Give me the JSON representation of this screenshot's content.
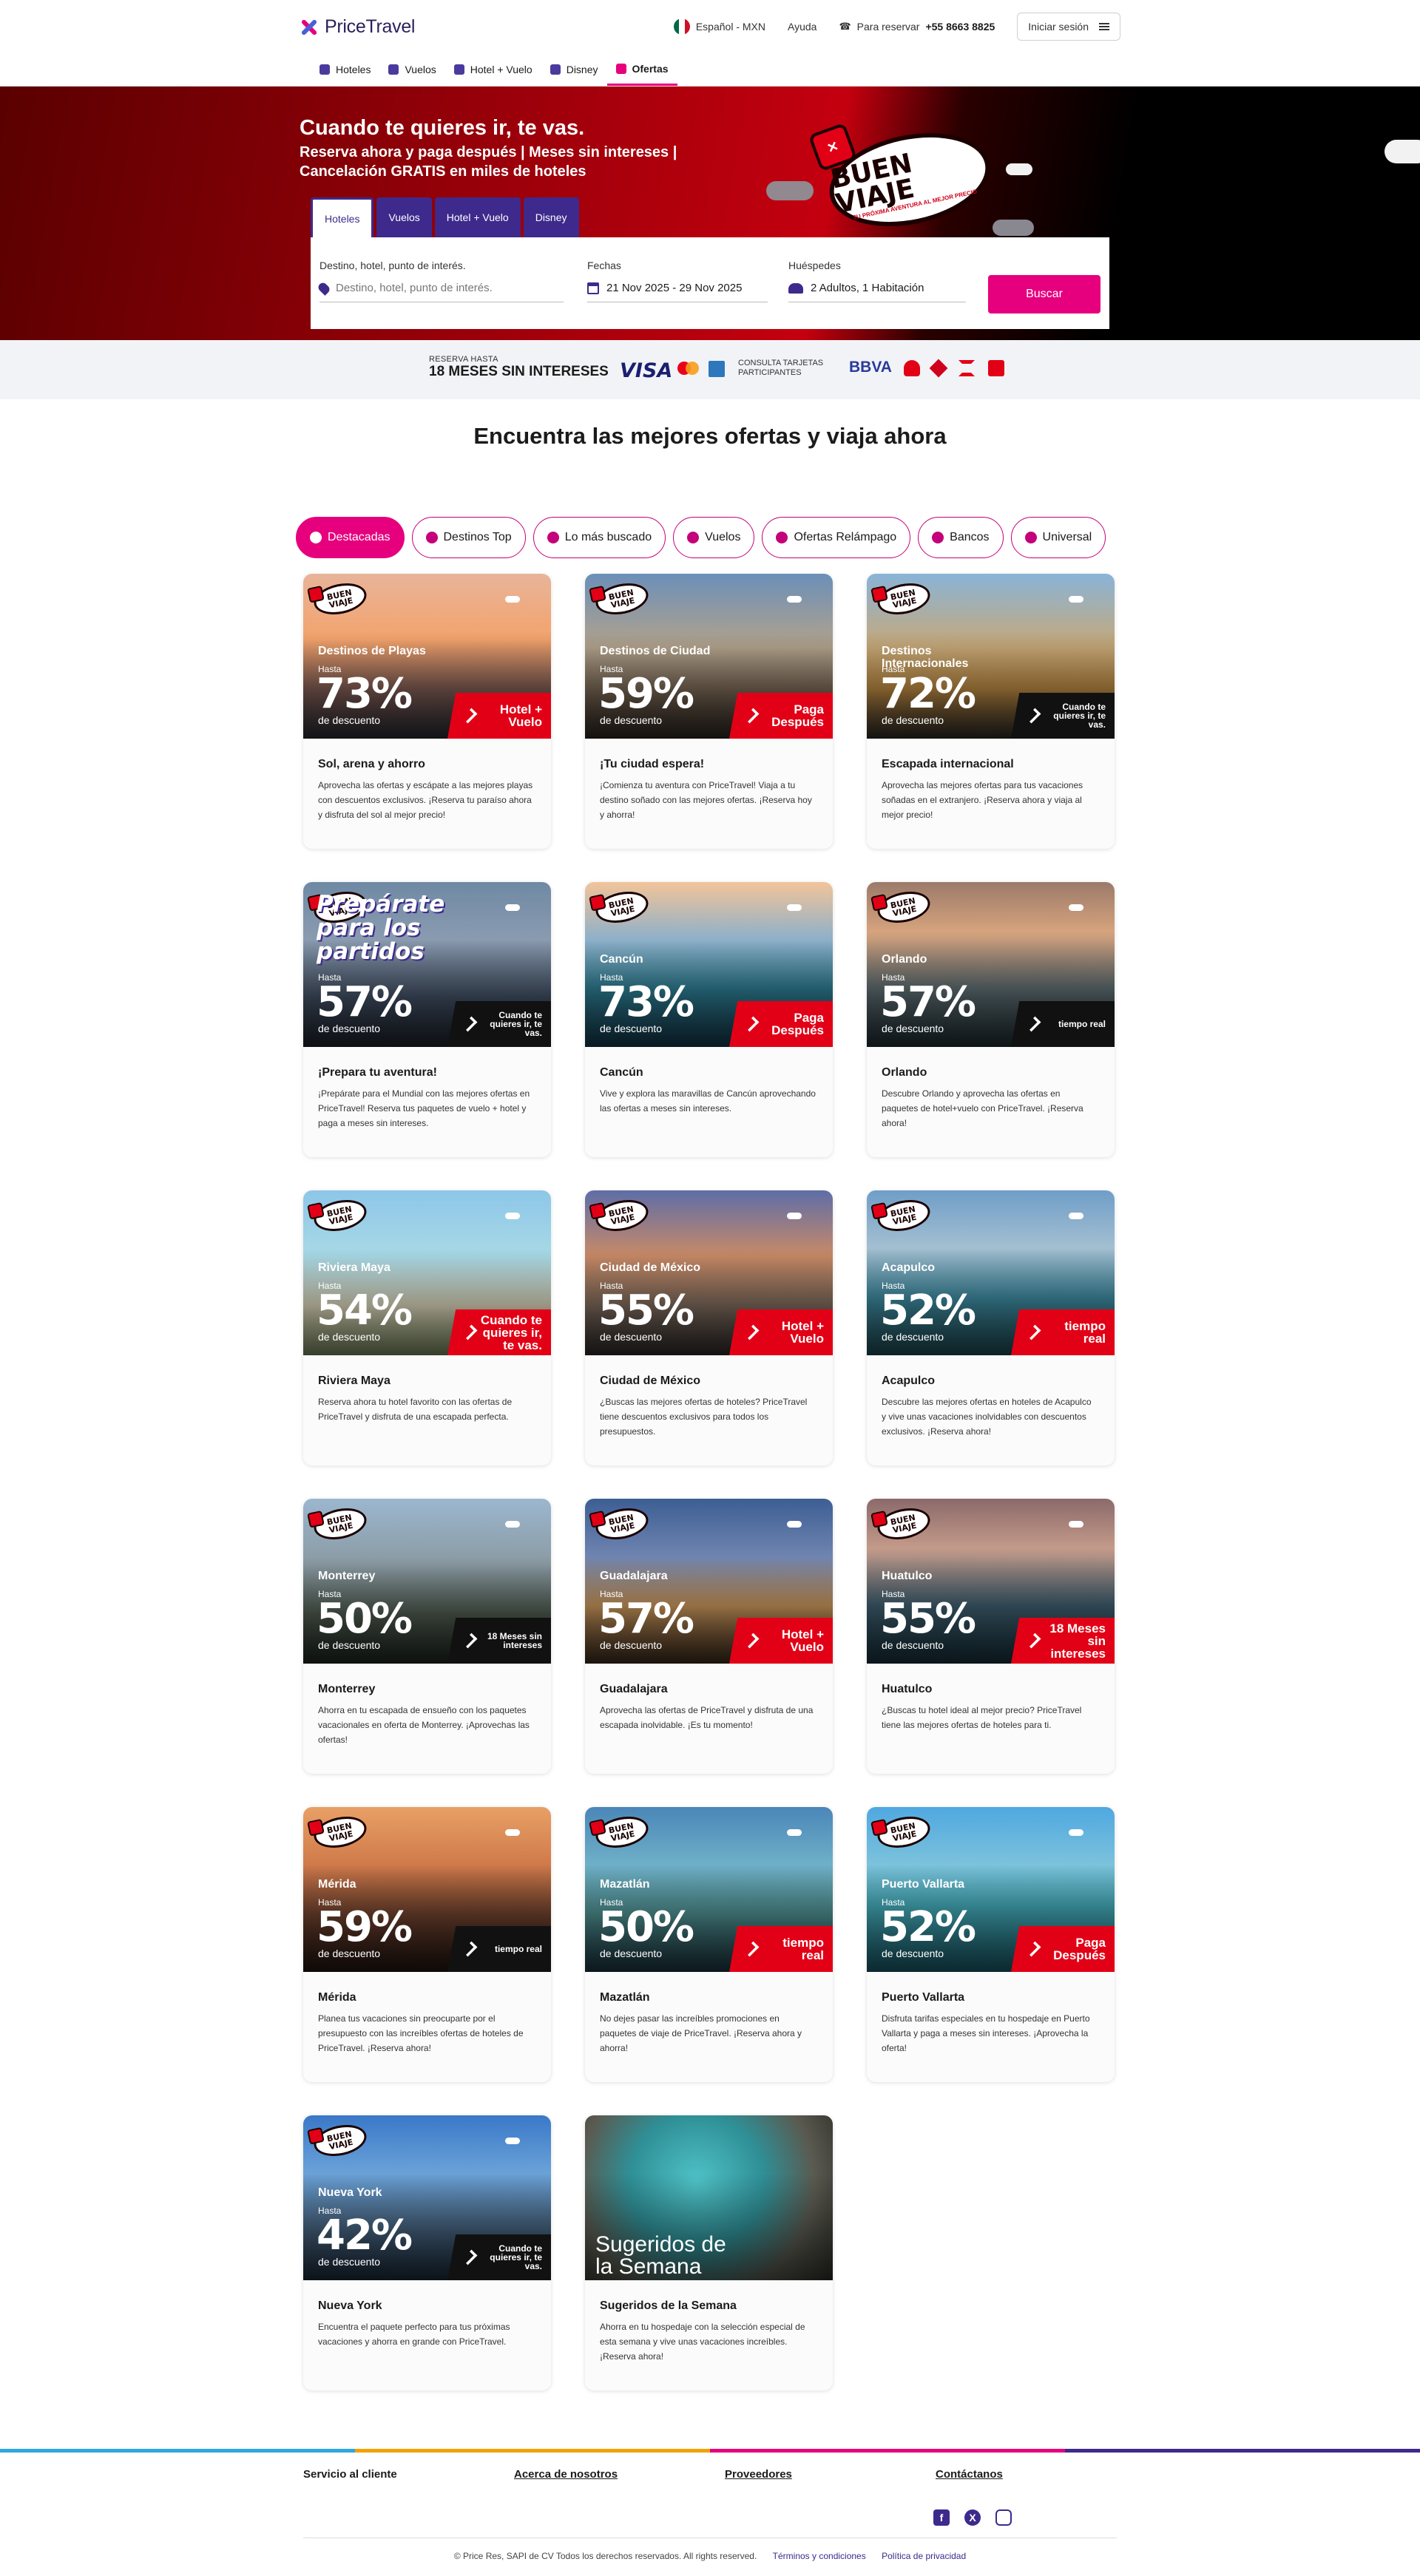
{
  "header": {
    "brand": "PriceTravel",
    "language": "Español - MXN",
    "help": "Ayuda",
    "reserve_label": "Para reservar",
    "phone": "+55 8663 8825",
    "login": "Iniciar sesión"
  },
  "nav": {
    "items": [
      {
        "label": "Hoteles",
        "icon": "bed-icon"
      },
      {
        "label": "Vuelos",
        "icon": "plane-icon"
      },
      {
        "label": "Hotel + Vuelo",
        "icon": "suitcase-icon"
      },
      {
        "label": "Disney",
        "icon": "mickey-icon"
      },
      {
        "label": "Ofertas",
        "icon": "flame-icon"
      }
    ],
    "active": "Ofertas"
  },
  "hero": {
    "title": "Cuando te quieres ir, te vas.",
    "subtitle": "Reserva ahora y paga después | Meses sin intereses | Cancelación GRATIS en miles de hoteles",
    "badge_big": "BUEN VIAJE",
    "badge_small": "Tu próxima aventura al mejor precio",
    "tabs": [
      "Hoteles",
      "Vuelos",
      "Hotel + Vuelo",
      "Disney"
    ],
    "active_tab": "Hoteles",
    "destination_label": "Destino, hotel, punto de interés.",
    "destination_placeholder": "Destino, hotel, punto de interés.",
    "dates_label": "Fechas",
    "dates_value": "21 Nov 2025 - 29 Nov 2025",
    "guests_label": "Huéspedes",
    "guests_value": "2 Adultos, 1 Habitación",
    "search_button": "Buscar"
  },
  "payments": {
    "line1": "RESERVA HASTA",
    "line2": "18 MESES SIN INTERESES",
    "visa": "VISA",
    "note": "CONSULTA TARJETAS PARTICIPANTES",
    "bank": "BBVA"
  },
  "main": {
    "title": "Encuentra las mejores ofertas y viaja ahora",
    "filters": [
      {
        "label": "Destacadas",
        "icon": "star-icon"
      },
      {
        "label": "Destinos Top",
        "icon": "pin-icon"
      },
      {
        "label": "Lo más buscado",
        "icon": "search-icon"
      },
      {
        "label": "Vuelos",
        "icon": "plane-icon"
      },
      {
        "label": "Ofertas Relámpago",
        "icon": "bolt-icon"
      },
      {
        "label": "Bancos",
        "icon": "bank-icon"
      },
      {
        "label": "Universal",
        "icon": "globe-icon"
      }
    ],
    "active_filter": "Destacadas"
  },
  "cards": [
    {
      "dest": "Destinos de Playas",
      "pct": "73%",
      "promo": "Hotel + Vuelo",
      "promo_style": "red",
      "title": "Sol, arena y ahorro",
      "text": "Aprovecha las ofertas y escápate a las mejores playas con descuentos exclusivos. ¡Reserva tu paraíso ahora y disfruta del sol al mejor precio!",
      "bg": "linear-gradient(180deg,#e8b49a 0%,#f3a36c 40%,#7d5a52 70%,#2a2b34 100%)"
    },
    {
      "dest": "Destinos de Ciudad",
      "pct": "59%",
      "promo": "Paga Después",
      "promo_style": "red",
      "title": "¡Tu ciudad espera!",
      "text": "¡Comienza tu aventura con PriceTravel! Viaja a tu destino soñado con las mejores ofertas. ¡Reserva hoy y ahorra!",
      "bg": "linear-gradient(180deg,#6b8fb8 0%,#b3a38c 45%,#6b5a4a 75%,#2c2620 100%)"
    },
    {
      "dest": "Destinos Internacionales",
      "pct": "72%",
      "promo": "Cuando te quieres ir, te vas.",
      "promo_style": "dark",
      "title": "Escapada internacional",
      "text": "Aprovecha las mejores ofertas para tus vacaciones soñadas en el extranjero. ¡Reserva ahora y viaja al mejor precio!",
      "bg": "linear-gradient(180deg,#89b4d8 0%,#c7a877 45%,#b6853f 70%,#2d2a26 100%)"
    },
    {
      "dest": "",
      "pct": "57%",
      "promo": "Cuando te quieres ir, te vas.",
      "promo_style": "dark",
      "promo_text": "Prepárate para los partidos",
      "title": "¡Prepara tu aventura!",
      "text": "¡Prepárate para el Mundial con las mejores ofertas en PriceTravel! Reserva tus paquetes de vuelo + hotel y paga a meses sin intereses.",
      "bg": "linear-gradient(180deg,#6f89a4 0%,#8a9bb0 35%,#3f4c60 70%,#1d222c 100%)"
    },
    {
      "dest": "Cancún",
      "pct": "73%",
      "promo": "Paga Después",
      "promo_style": "red",
      "title": "Cancún",
      "text": "Vive y explora las maravillas de Cancún aprovechando las ofertas a meses sin intereses.",
      "bg": "linear-gradient(180deg,#f2c49a 0%,#8db0c9 35%,#2c7a8f 65%,#13384a 100%)"
    },
    {
      "dest": "Orlando",
      "pct": "57%",
      "promo": "tiempo real",
      "promo_style": "dark",
      "title": "Orlando",
      "text": "Descubre Orlando y aprovecha las ofertas en paquetes de hotel+vuelo con PriceTravel. ¡Reserva ahora!",
      "bg": "linear-gradient(180deg,#9b7a6a 0%,#d6a37d 30%,#5b6a6f 65%,#1f2d33 100%)"
    },
    {
      "dest": "Riviera Maya",
      "pct": "54%",
      "promo": "Cuando te quieres ir, te vas.",
      "promo_style": "red",
      "title": "Riviera Maya",
      "text": "Reserva ahora tu hotel favorito con las ofertas de PriceTravel y disfruta de una escapada perfecta.",
      "bg": "linear-gradient(180deg,#8dc6e8 0%,#a8d9e6 40%,#d9d3b8 70%,#7a8a60 100%)"
    },
    {
      "dest": "Ciudad de México",
      "pct": "55%",
      "promo": "Hotel + Vuelo",
      "promo_style": "red",
      "title": "Ciudad de México",
      "text": "¿Buscas las mejores ofertas de hoteles? PriceTravel tiene descuentos exclusivos para todos los presupuestos.",
      "bg": "linear-gradient(180deg,#5e6da8 0%,#c98a66 40%,#7d6a5c 70%,#2e2a2a 100%)"
    },
    {
      "dest": "Acapulco",
      "pct": "52%",
      "promo": "tiempo real",
      "promo_style": "red",
      "title": "Acapulco",
      "text": "Descubre las mejores ofertas en hoteles de Acapulco y vive unas vacaciones inolvidables con descuentos exclusivos. ¡Reserva ahora!",
      "bg": "linear-gradient(180deg,#6f9ec8 0%,#a4bfd1 35%,#3e8aa0 65%,#1e4a52 100%)"
    },
    {
      "dest": "Monterrey",
      "pct": "50%",
      "promo": "18 Meses sin intereses",
      "promo_style": "dark",
      "title": "Monterrey",
      "text": "Ahorra en tu escapada de ensueño con los paquetes vacacionales en oferta de Monterrey. ¡Aprovechas las ofertas!",
      "bg": "linear-gradient(180deg,#9bb7cf 0%,#8a9aa3 40%,#4d5a4e 70%,#1f2620 100%)"
    },
    {
      "dest": "Guadalajara",
      "pct": "57%",
      "promo": "Hotel + Vuelo",
      "promo_style": "red",
      "title": "Guadalajara",
      "text": "Aprovecha las ofertas de PriceTravel y disfruta de una escapada inolvidable. ¡Es tu momento!",
      "bg": "linear-gradient(180deg,#3d5e94 0%,#6f84b0 35%,#c7955a 65%,#3b2a1c 100%)"
    },
    {
      "dest": "Huatulco",
      "pct": "55%",
      "promo": "18 Meses sin intereses",
      "promo_style": "red",
      "title": "Huatulco",
      "text": "¿Buscas tu hotel ideal al mejor precio? PriceTravel tiene las mejores ofertas de hoteles para ti.",
      "bg": "linear-gradient(180deg,#8b6a6a 0%,#c49a8a 30%,#3d5d6e 65%,#17303b 100%)"
    },
    {
      "dest": "Mérida",
      "pct": "59%",
      "promo": "tiempo real",
      "promo_style": "dark",
      "title": "Mérida",
      "text": "Planea tus vacaciones sin preocuparte por el presupuesto con las increíbles ofertas de hoteles de PriceTravel. ¡Reserva ahora!",
      "bg": "linear-gradient(180deg,#e8a066 0%,#d07a4a 35%,#6b3f2c 65%,#1f1410 100%)"
    },
    {
      "dest": "Mazatlán",
      "pct": "50%",
      "promo": "tiempo real",
      "promo_style": "red",
      "title": "Mazatlán",
      "text": "No dejes pasar las increíbles promociones en paquetes de viaje de PriceTravel. ¡Reserva ahora y ahorra!",
      "bg": "linear-gradient(180deg,#4a86b8 0%,#6fb0c8 35%,#4b8a8a 65%,#1b3440 100%)"
    },
    {
      "dest": "Puerto Vallarta",
      "pct": "52%",
      "promo": "Paga Después",
      "promo_style": "red",
      "title": "Puerto Vallarta",
      "text": "Disfruta tarifas especiales en tu hospedaje en Puerto Vallarta y paga a meses sin intereses. ¡Aprovecha la oferta!",
      "bg": "linear-gradient(180deg,#4fa8e0 0%,#7cc2dc 35%,#40a3b0 60%,#1a5a68 100%)"
    },
    {
      "dest": "Nueva York",
      "pct": "42%",
      "promo": "Cuando te quieres ir, te vas.",
      "promo_style": "dark",
      "title": "Nueva York",
      "text": "Encuentra el paquete perfecto para tus próximas vacaciones y ahorra en grande con PriceTravel.",
      "bg": "linear-gradient(180deg,#3a78c8 0%,#6aa2d8 35%,#4b6a88 65%,#1b2a3a 100%)"
    },
    {
      "dest": "",
      "pct": "",
      "promo": "",
      "promo_style": "none",
      "promo_text": "Sugeridos de la Semana",
      "title": "Sugeridos de la Semana",
      "text": "Ahorra en tu hospedaje con la selección especial de esta semana y vive unas vacaciones increíbles. ¡Reserva ahora!",
      "bg": "radial-gradient(circle at 45% 40%,#4fc3c8 0%,#2f8f96 40%,#5a5a50 70%,#2a2a26 100%)"
    }
  ],
  "card_common": {
    "hasta": "Hasta",
    "descuento": "de descuento",
    "badge": "BUEN VIAJE"
  },
  "footer": {
    "links": [
      "Servicio al cliente",
      "Acerca de nosotros",
      "Proveedores",
      "Contáctanos"
    ],
    "social": [
      "facebook-icon",
      "x-icon",
      "instagram-icon"
    ],
    "copyright": "© Price Res, SAPI de CV Todos los derechos reservados. All rights reserved.",
    "terms": "Términos y condiciones",
    "privacy": "Política de privacidad"
  },
  "colors": {
    "brand_pink": "#e6007e",
    "brand_purple": "#3d2a8c",
    "promo_red": "#e20016"
  }
}
